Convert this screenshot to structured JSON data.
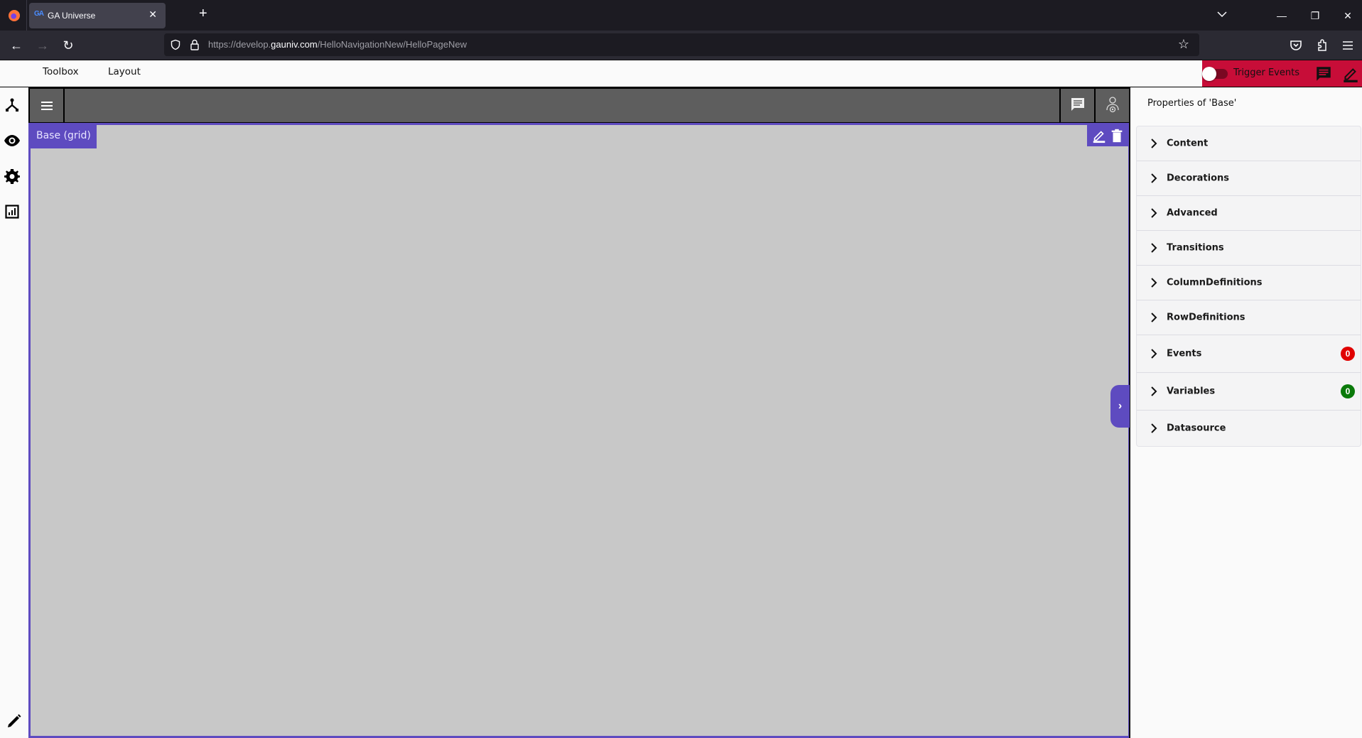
{
  "browser": {
    "tab_title": "GA Universe",
    "tab_favicon": "GA",
    "url_prefix": "https://develop.",
    "url_domain": "gauniv.com",
    "url_path": "/HelloNavigationNew/HelloPageNew"
  },
  "header": {
    "menu": [
      "Toolbox",
      "Layout"
    ],
    "trigger_events_label": "Trigger Events",
    "trigger_events_on": false,
    "accent_color": "#c70d38"
  },
  "canvas": {
    "element_label": "Base (grid)",
    "accent_color": "#5e4bc0",
    "background": "#c8c8c8"
  },
  "properties": {
    "title": "Properties of 'Base'",
    "sections": [
      {
        "label": "Content"
      },
      {
        "label": "Decorations"
      },
      {
        "label": "Advanced"
      },
      {
        "label": "Transitions"
      },
      {
        "label": "ColumnDefinitions"
      },
      {
        "label": "RowDefinitions"
      },
      {
        "label": "Events",
        "badge": "0",
        "badge_color": "#e00000"
      },
      {
        "label": "Variables",
        "badge": "0",
        "badge_color": "#0a7a0a"
      },
      {
        "label": "Datasource"
      }
    ]
  }
}
